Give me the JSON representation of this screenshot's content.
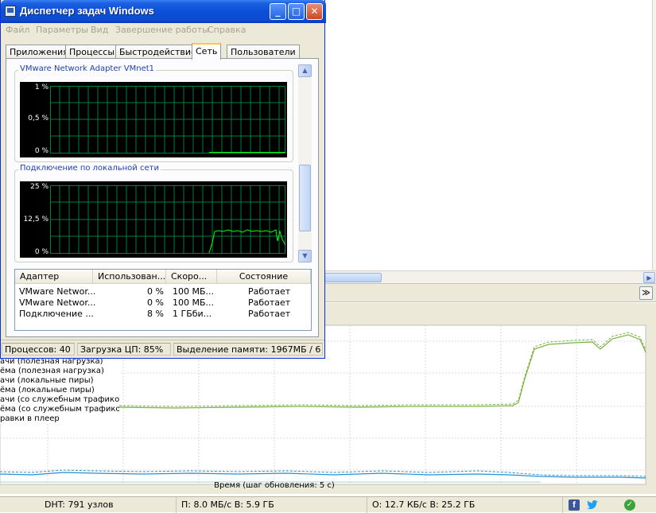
{
  "task_manager": {
    "title": "Диспетчер задач Windows",
    "menu": [
      "Файл",
      "Параметры",
      "Вид",
      "Завершение работы",
      "Справка"
    ],
    "tabs": [
      "Приложения",
      "Процессы",
      "Быстродействие",
      "Сеть",
      "Пользователи"
    ],
    "active_tab": "Сеть",
    "groups": [
      {
        "label": "VMware Network Adapter VMnet1",
        "y_ticks": [
          "1 %",
          "0,5 %",
          "0 %"
        ]
      },
      {
        "label": "Подключение по локальной сети",
        "y_ticks": [
          "25 %",
          "12,5 %",
          "0 %"
        ]
      }
    ],
    "adapter_table": {
      "columns": [
        "Адаптер",
        "Использован...",
        "Скоро...",
        "Состояние"
      ],
      "rows": [
        [
          "VMware Networ...",
          "0 %",
          "100 МБ...",
          "Работает"
        ],
        [
          "VMware Networ...",
          "0 %",
          "100 МБ...",
          "Работает"
        ],
        [
          "Подключение ...",
          "8 %",
          "1 ГБби...",
          "Работает"
        ]
      ]
    },
    "status": {
      "processes": "Процессов: 40",
      "cpu": "Загрузка ЦП: 85%",
      "memory": "Выделение памяти: 1967МБ / 6"
    },
    "colors": {
      "title_bar": "#0a50d8",
      "graph_bg": "#000000",
      "graph_grid": "#008040",
      "graph_line": "#00ff00"
    }
  },
  "torrent_client": {
    "legend": [
      "ачи (полезная нагрузка)",
      "ёма (полезная нагрузка)",
      "ачи (локальные пиры)",
      "ёма (локальные пиры)",
      "ачи (со служебным трафиком)",
      "ёма (со служебным трафиком)",
      "равки в плеер"
    ],
    "time_caption": "Время (шаг обновления: 5 с)",
    "status": {
      "dht": "DHT: 791 узлов",
      "download": "П: 8.0 МБ/с В: 5.9 ГБ",
      "upload": "О: 12.7 КБ/с В: 25.2 ГБ"
    },
    "colors": {
      "download_line": "#7cb342",
      "upload_line": "#2a8fd0"
    }
  }
}
